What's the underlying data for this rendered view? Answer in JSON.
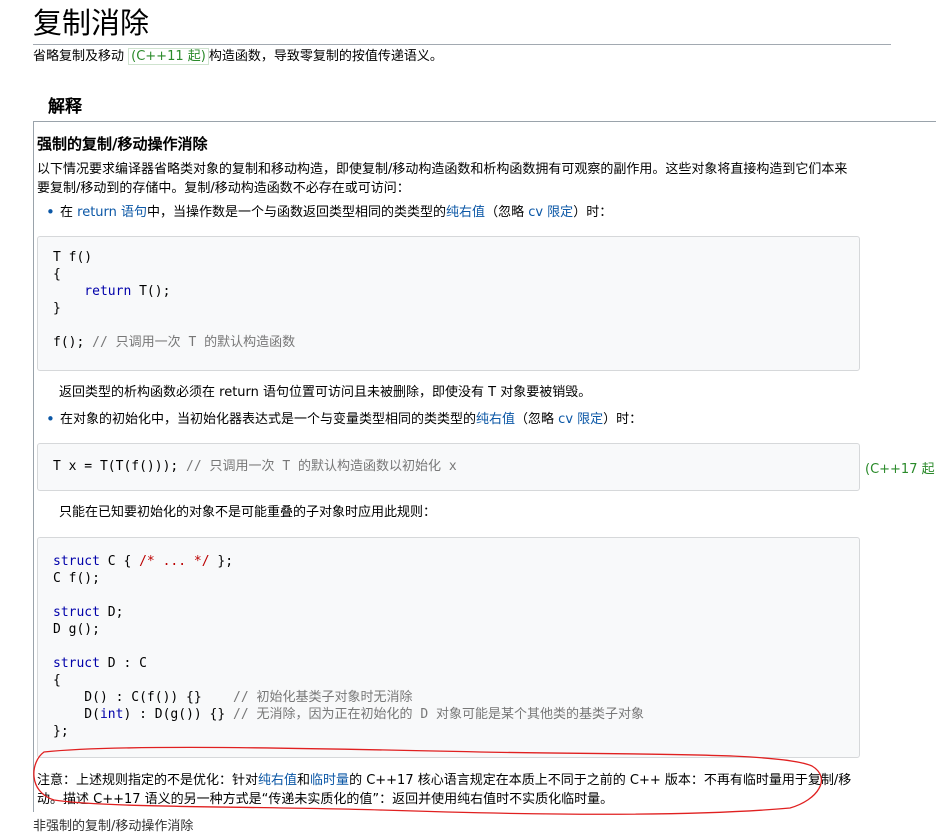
{
  "title": "复制消除",
  "subtitle": {
    "before": "省略复制及移动 ",
    "tag": "(C++11 起)",
    "after": "构造函数，导致零复制的按值传递语义。"
  },
  "h_explain": "解释",
  "h_forced": "强制的复制/移动操作消除",
  "intro": "以下情况要求编译器省略类对象的复制和移动构造，即使复制/移动构造函数和析构函数拥有可观察的副作用。这些对象将直接构造到它们本来要复制/移动到的存储中。复制/移动构造函数不必存在或可访问：",
  "bullet1": {
    "a": "在 ",
    "link1": "return 语句",
    "b": "中，当操作数是一个与函数返回类型相同的类类型的",
    "link2": "纯右值",
    "c": "（忽略 ",
    "link3": "cv 限定",
    "d": "）时："
  },
  "code1": {
    "l1": "T f()",
    "l2": "{",
    "l3a": "    return",
    "l3b": " T();",
    "l4": "}",
    "l5a": "f();",
    "l5b": " // 只调用一次 T 的默认构造函数"
  },
  "note1": "返回类型的析构函数必须在 return 语句位置可访问且未被删除，即使没有 T 对象要被销毁。",
  "bullet2": {
    "a": "在对象的初始化中，当初始化器表达式是一个与变量类型相同的类类型的",
    "link1": "纯右值",
    "b": "（忽略 ",
    "link2": "cv 限定",
    "c": "）时："
  },
  "code2": {
    "a": "T x = T(T(f()));",
    "b": " // 只调用一次 T 的默认构造函数以初始化 x"
  },
  "tag_cpp17": "(C++17 起",
  "note2": "只能在已知要初始化的对象不是可能重叠的子对象时应用此规则：",
  "code3": {
    "l1a": "struct",
    "l1b": " C { ",
    "l1c": "/* ... */",
    "l1d": " };",
    "l2": "C f();",
    "l4a": "struct",
    "l4b": " D;",
    "l5": "D g();",
    "l7a": "struct",
    "l7b": " D : C",
    "l8": "{",
    "l9a": "    D() : C(f()) {}    ",
    "l9b": "// 初始化基类子对象时无消除",
    "l10a": "    D(",
    "l10b": "int",
    "l10c": ") : D(g()) {} ",
    "l10d": "// 无消除，因为正在初始化的 D 对象可能是某个其他类的基类子对象",
    "l11": "};"
  },
  "bottom_note": {
    "a": "注意：上述规则指定的不是优化：针对",
    "link1": "纯右值",
    "b": "和",
    "link2": "临时量",
    "c": "的 C++17 核心语言规定在本质上不同于之前的 C++ 版本：不再有临时量用于复制/移动。描述 C++17 语义的另一种方式是“传递未实质化的值”：返回并使用纯右值时不实质化临时量。"
  },
  "cut_line": "非强制的复制/移动操作消除",
  "colors": {
    "link": "#0b57a6",
    "tag": "#2a8a2a",
    "annotation": "#e02020",
    "code_bg": "#f8f9fa"
  }
}
